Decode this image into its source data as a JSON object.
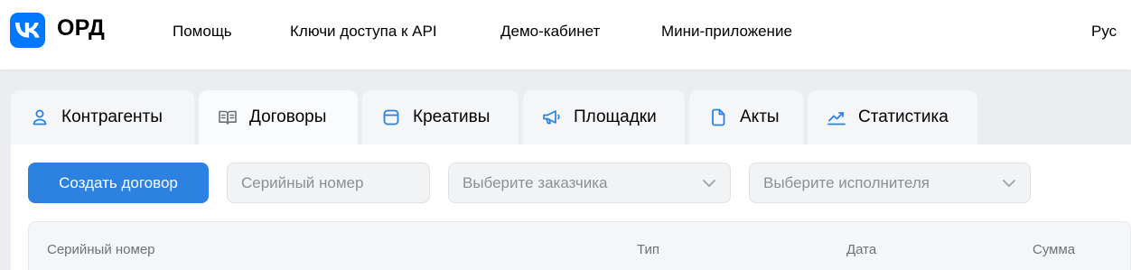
{
  "header": {
    "logo_glyph": "VK",
    "title": "ОРД",
    "nav": [
      {
        "label": "Помощь"
      },
      {
        "label": "Ключи доступа к API"
      },
      {
        "label": "Демо-кабинет"
      },
      {
        "label": "Мини-приложение"
      }
    ],
    "language": "Рус"
  },
  "tabs": [
    {
      "label": "Контрагенты",
      "icon": "user-icon",
      "active": false
    },
    {
      "label": "Договоры",
      "icon": "book-icon",
      "active": true
    },
    {
      "label": "Креативы",
      "icon": "window-icon",
      "active": false
    },
    {
      "label": "Площадки",
      "icon": "megaphone-icon",
      "active": false
    },
    {
      "label": "Акты",
      "icon": "document-icon",
      "active": false
    },
    {
      "label": "Статистика",
      "icon": "trend-up-icon",
      "active": false
    }
  ],
  "toolbar": {
    "create_label": "Создать договор",
    "serial_placeholder": "Серийный номер",
    "customer_placeholder": "Выберите заказчика",
    "executor_placeholder": "Выберите исполнителя"
  },
  "table": {
    "columns": [
      "Серийный номер",
      "Тип",
      "Дата",
      "Сумма"
    ]
  },
  "colors": {
    "brand": "#0077ff",
    "primary_button": "#2d81e0",
    "icon": "#2d81e0"
  }
}
